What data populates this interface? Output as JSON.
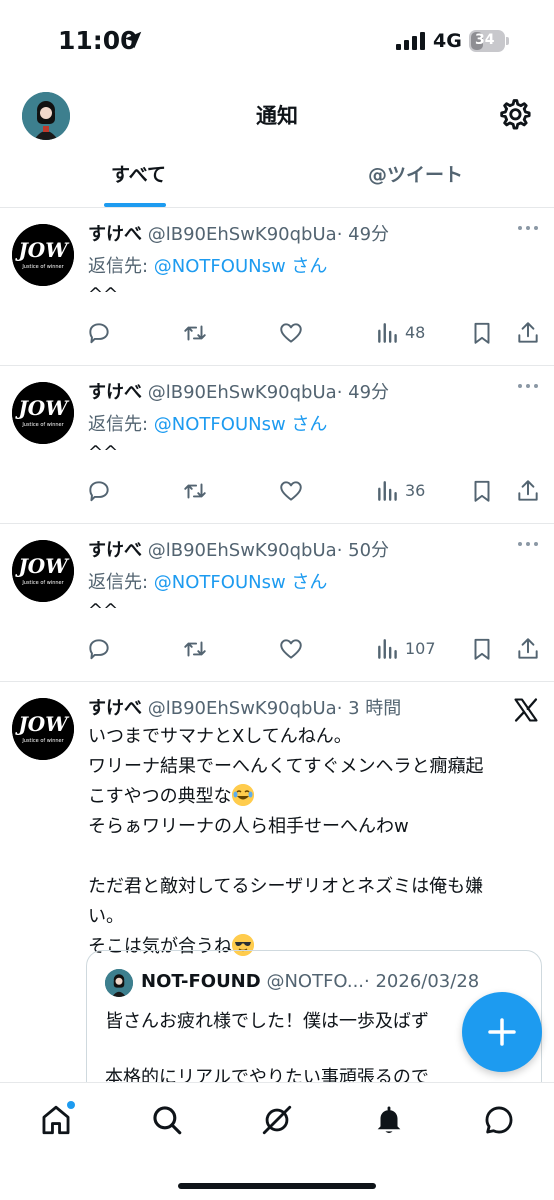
{
  "status_bar": {
    "time": "11:00",
    "network": "4G",
    "battery": "34"
  },
  "header": {
    "title": "通知"
  },
  "tabs": [
    {
      "label": "すべて"
    },
    {
      "label": "@ツイート"
    }
  ],
  "tweets": [
    {
      "name": "すけべ",
      "handle": "@lB90EhSwK90qbUa",
      "time": "· 49分",
      "reply_prefix": "返信先: ",
      "reply_handle": "@NOTFOUNsw",
      "reply_suffix": " さん",
      "text": "^^",
      "views": "48"
    },
    {
      "name": "すけべ",
      "handle": "@lB90EhSwK90qbUa",
      "time": "· 49分",
      "reply_prefix": "返信先: ",
      "reply_handle": "@NOTFOUNsw",
      "reply_suffix": " さん",
      "text": "^^",
      "views": "36"
    },
    {
      "name": "すけべ",
      "handle": "@lB90EhSwK90qbUa",
      "time": "· 50分",
      "reply_prefix": "返信先: ",
      "reply_handle": "@NOTFOUNsw",
      "reply_suffix": " さん",
      "text": "^^",
      "views": "107"
    }
  ],
  "long_tweet": {
    "name": "すけべ",
    "handle": "@lB90EhSwK90qbUa",
    "time": "· 3 時間",
    "lines": [
      "いつまでサマナとXしてんねん。",
      "ワリーナ結果でーへんくてすぐメンヘラと癇癪起",
      "こすやつの典型な",
      "そらぁワリーナの人ら相手せーへんわw",
      "",
      "ただ君と敵対してるシーザリオとネズミは俺も嫌",
      "い。",
      "そこは気が合うね"
    ],
    "quote": {
      "name": "NOT-FOUND",
      "handle": "@NOTFO...",
      "date": "· 2026/03/28",
      "line1": "皆さんお疲れ様でした！僕は一歩及ばず",
      "line2": "本格的にリアルでやりたい事頑張るので"
    }
  },
  "icons": {
    "location": "location-arrow-icon",
    "settings": "gear-icon",
    "reply": "reply-icon",
    "retweet": "retweet-icon",
    "like": "heart-icon",
    "views": "views-icon",
    "bookmark": "bookmark-icon",
    "share": "share-icon",
    "x_logo": "x-logo-icon",
    "compose": "plus-icon"
  },
  "colors": {
    "accent": "#1d9bf0",
    "text": "#0f1419",
    "muted": "#536471",
    "emoji": "#ffcc4d"
  }
}
